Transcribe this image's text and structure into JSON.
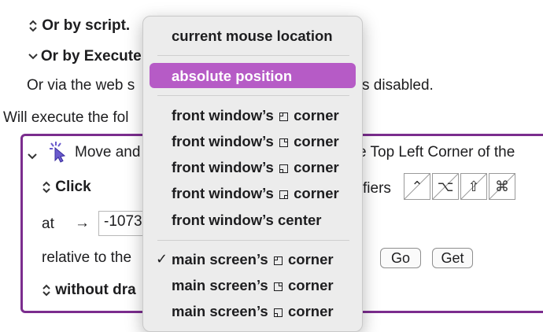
{
  "background": {
    "or_by_script": "Or by script.",
    "or_by_execute": "Or by Execute",
    "web_line_left": "Or via the web s",
    "web_line_right": "s disabled.",
    "will_execute": "Will execute the fol"
  },
  "action": {
    "title_left": "Move and",
    "title_right": "e Top Left Corner of the",
    "click_label": "Click",
    "modifiers_label": "fiers",
    "at_label": "at",
    "arrow": "→",
    "x_value": "-1073",
    "relative_label": "relative to the",
    "go_button": "Go",
    "get_button": "Get",
    "drag_label": "without dra",
    "modifiers": [
      {
        "name": "control",
        "glyph": "⌃"
      },
      {
        "name": "option",
        "glyph": "⌥"
      },
      {
        "name": "shift",
        "glyph": "⇧"
      },
      {
        "name": "command",
        "glyph": "⌘"
      }
    ]
  },
  "menu": {
    "items": [
      {
        "label": "current mouse location",
        "highlighted": false,
        "checked": false
      },
      {
        "label": "absolute position",
        "highlighted": true,
        "checked": false
      },
      {
        "label_before": "front window’s",
        "label_after": "corner",
        "corner": "tl",
        "checked": false
      },
      {
        "label_before": "front window’s",
        "label_after": "corner",
        "corner": "tr",
        "checked": false
      },
      {
        "label_before": "front window’s",
        "label_after": "corner",
        "corner": "bl",
        "checked": false
      },
      {
        "label_before": "front window’s",
        "label_after": "corner",
        "corner": "br",
        "checked": false
      },
      {
        "label": "front window’s center",
        "checked": false
      },
      {
        "label_before": "main screen’s",
        "label_after": "corner",
        "corner": "tl",
        "checked": true
      },
      {
        "label_before": "main screen’s",
        "label_after": "corner",
        "corner": "tr",
        "checked": false
      },
      {
        "label_before": "main screen’s",
        "label_after": "corner",
        "corner": "bl",
        "checked": false
      }
    ],
    "checkmark": "✓"
  },
  "colors": {
    "accent_purple": "#7b2d8e",
    "menu_highlight": "#b65bc6",
    "cursor_icon": "#6a5acd"
  }
}
